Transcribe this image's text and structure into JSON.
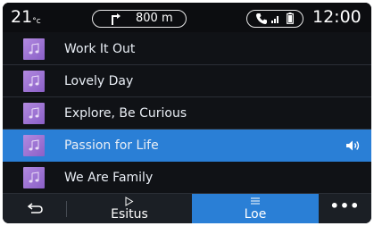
{
  "status": {
    "temperature": "21",
    "temperature_unit": "°c",
    "nav_distance": "800 m",
    "clock": "12:00"
  },
  "tracks": [
    {
      "title": "Work It Out"
    },
    {
      "title": "Lovely Day"
    },
    {
      "title": "Explore, Be Curious"
    },
    {
      "title": "Passion for Life"
    },
    {
      "title": "We Are Family"
    }
  ],
  "playing_index": 3,
  "bottom": {
    "play_label": "Esitus",
    "list_label": "Loe",
    "more_label": "•••"
  },
  "colors": {
    "accent": "#2a7fd6",
    "background": "#101216",
    "thumbnail": "#a77dd8"
  },
  "icons": [
    "turn-right-icon",
    "phone-icon",
    "signal-icon",
    "battery-icon",
    "music-note-icon",
    "speaker-icon",
    "back-icon",
    "play-icon",
    "list-icon",
    "more-icon"
  ]
}
